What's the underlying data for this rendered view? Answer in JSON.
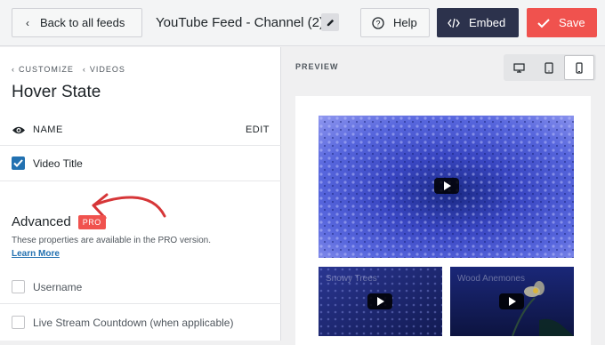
{
  "topbar": {
    "back_label": "Back to all feeds",
    "feed_title": "YouTube Feed - Channel (2)",
    "help_label": "Help",
    "embed_label": "Embed",
    "save_label": "Save"
  },
  "sidebar": {
    "crumbs": [
      "CUSTOMIZE",
      "VIDEOS"
    ],
    "title": "Hover State",
    "name_label": "NAME",
    "edit_label": "EDIT",
    "video_title_label": "Video Title",
    "video_title_checked": true,
    "advanced_title": "Advanced",
    "pro_badge": "PRO",
    "advanced_desc": "These properties are available in the PRO version.",
    "learn_more": "Learn More",
    "pro_options": [
      "Username",
      "Live Stream Countdown (when applicable)"
    ]
  },
  "preview": {
    "label": "PREVIEW",
    "devices": [
      "desktop-icon",
      "tablet-icon",
      "mobile-icon"
    ],
    "active_device": "mobile",
    "thumbs": [
      {
        "title": "Snowy Trees"
      },
      {
        "title": "Wood Anemones"
      }
    ]
  },
  "colors": {
    "accent_blue": "#2271b1",
    "save_red": "#f0524e",
    "embed_navy": "#2c324c",
    "annotation_red": "#d63638"
  }
}
